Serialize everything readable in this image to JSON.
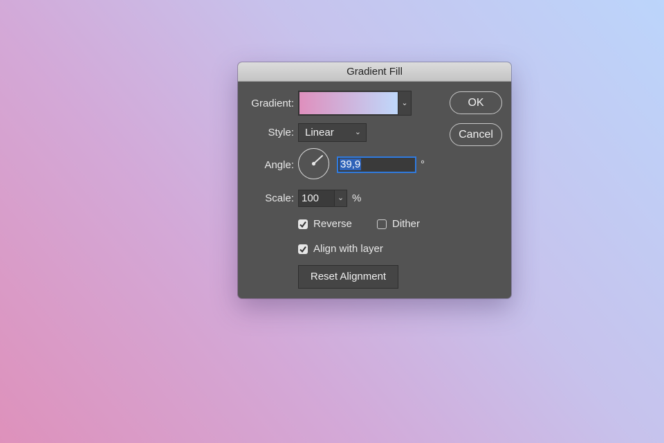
{
  "dialog": {
    "title": "Gradient Fill",
    "gradient": {
      "label": "Gradient:",
      "from_color": "#df8fbd",
      "to_color": "#bfd8fb"
    },
    "style": {
      "label": "Style:",
      "selected": "Linear"
    },
    "angle": {
      "label": "Angle:",
      "value": "39,9",
      "unit": "°"
    },
    "scale": {
      "label": "Scale:",
      "value": "100",
      "unit": "%"
    },
    "reverse": {
      "label": "Reverse",
      "checked": true
    },
    "dither": {
      "label": "Dither",
      "checked": false
    },
    "align_with_layer": {
      "label": "Align with layer",
      "checked": true
    },
    "reset_alignment_label": "Reset Alignment",
    "ok_label": "OK",
    "cancel_label": "Cancel"
  },
  "icons": {
    "dropdown": "chevron-down-icon",
    "checkmark": "checkmark-icon"
  }
}
